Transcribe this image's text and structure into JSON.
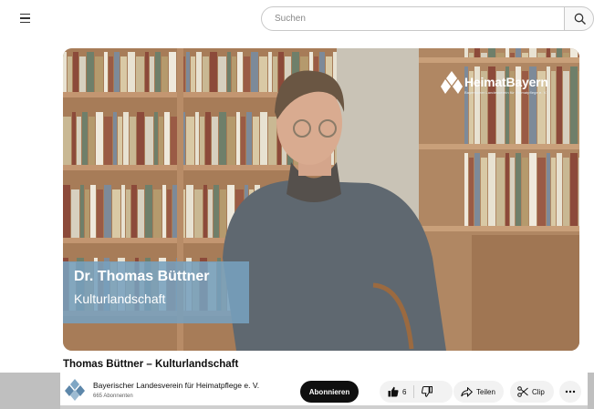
{
  "header": {
    "menu_icon": "hamburger-menu-icon",
    "search_placeholder": "Suchen",
    "search_icon": "search-icon"
  },
  "video": {
    "logo_text": "HeimatBayern",
    "logo_subtitle": "Bayerischer Landesverein für Heimatpflege e. V.",
    "lower_third_name": "Dr. Thomas Büttner",
    "lower_third_topic": "Kulturlandschaft"
  },
  "info": {
    "title": "Thomas Büttner – Kulturlandschaft",
    "channel_name": "Bayerischer Landesverein für Heimatpflege e. V.",
    "subscribers": "665 Abonnenten",
    "subscribe_label": "Abonnieren",
    "like_count": "6",
    "share_label": "Teilen",
    "clip_label": "Clip"
  },
  "colors": {
    "accent": "#0f0f0f",
    "lower_third": "#78a0be",
    "pill": "#f2f2f2"
  }
}
